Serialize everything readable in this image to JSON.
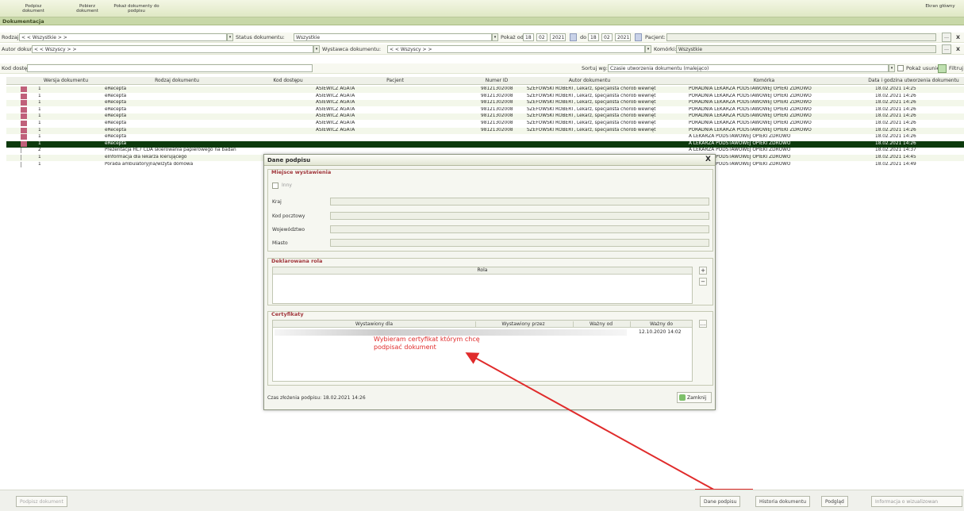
{
  "toolbar": {
    "btn1": "Podpisz dokument",
    "btn2": "Pobierz dokument",
    "btn3": "Pokaż dokumenty do podpisu",
    "right": "Ekran główny"
  },
  "section_title": "Dokumentacja",
  "filters": {
    "rodzaj_label": "Rodzaj:",
    "rodzaj_value": "< < Wszystkie > >",
    "status_label": "Status dokumentu:",
    "status_value": "Wszystkie",
    "pokaz_od_label": "Pokaż od",
    "date_from": [
      "18",
      "02",
      "2021"
    ],
    "do_label": "do",
    "date_to": [
      "18",
      "02",
      "2021"
    ],
    "pacjent_label": "Pacjent:",
    "autor_label": "Autor dokumentu:",
    "autor_value": "< < Wszyscy > >",
    "wystawca_label": "Wystawca dokumentu:",
    "wystawca_value": "< < Wszyscy > >",
    "komorka_label": "Komórki:",
    "komorka_value": "Wszystkie",
    "kod_label": "Kod dostępu:",
    "sortuj_label": "Sortuj wg:",
    "sortuj_value": "Czasie utworzenia dokumentu (malejąco)",
    "pokaz_usuniete": "Pokaż usunięte",
    "filtruj": "Filtruj"
  },
  "table": {
    "headers": [
      "Wersja dokumentu",
      "Rodzaj dokumentu",
      "Kod dostępu",
      "Pacjent",
      "Numer ID",
      "Autor dokumentu",
      "Komórka",
      "Data i godzina utworzenia dokumentu"
    ],
    "rows": [
      {
        "ver": "1",
        "type": "eRecepta",
        "patient": "ASIEWICZ AGATA",
        "id": "98121302008",
        "author": "SZEFOWSKI ROBERT, Lekarz, specjalista chorób wewnęt",
        "unit": "PORADNIA LEKARZA PODSTAWOWEJ OPIEKI ZDROWO",
        "date": "18.02.2021 14:25"
      },
      {
        "ver": "1",
        "type": "eRecepta",
        "patient": "ASIEWICZ AGATA",
        "id": "98121302008",
        "author": "SZEFOWSKI ROBERT, Lekarz, specjalista chorób wewnęt",
        "unit": "PORADNIA LEKARZA PODSTAWOWEJ OPIEKI ZDROWO",
        "date": "18.02.2021 14:26"
      },
      {
        "ver": "1",
        "type": "eRecepta",
        "patient": "ASIEWICZ AGATA",
        "id": "98121302008",
        "author": "SZEFOWSKI ROBERT, Lekarz, specjalista chorób wewnęt",
        "unit": "PORADNIA LEKARZA PODSTAWOWEJ OPIEKI ZDROWO",
        "date": "18.02.2021 14:26"
      },
      {
        "ver": "1",
        "type": "eRecepta",
        "patient": "ASIEWICZ AGATA",
        "id": "98121302008",
        "author": "SZEFOWSKI ROBERT, Lekarz, specjalista chorób wewnęt",
        "unit": "PORADNIA LEKARZA PODSTAWOWEJ OPIEKI ZDROWO",
        "date": "18.02.2021 14:26"
      },
      {
        "ver": "1",
        "type": "eRecepta",
        "patient": "ASIEWICZ AGATA",
        "id": "98121302008",
        "author": "SZEFOWSKI ROBERT, Lekarz, specjalista chorób wewnęt",
        "unit": "PORADNIA LEKARZA PODSTAWOWEJ OPIEKI ZDROWO",
        "date": "18.02.2021 14:26"
      },
      {
        "ver": "1",
        "type": "eRecepta",
        "patient": "ASIEWICZ AGATA",
        "id": "98121302008",
        "author": "SZEFOWSKI ROBERT, Lekarz, specjalista chorób wewnęt",
        "unit": "PORADNIA LEKARZA PODSTAWOWEJ OPIEKI ZDROWO",
        "date": "18.02.2021 14:26"
      },
      {
        "ver": "1",
        "type": "eRecepta",
        "patient": "ASIEWICZ AGATA",
        "id": "98121302008",
        "author": "SZEFOWSKI ROBERT, Lekarz, specjalista chorób wewnęt",
        "unit": "PORADNIA LEKARZA PODSTAWOWEJ OPIEKI ZDROWO",
        "date": "18.02.2021 14:26"
      },
      {
        "ver": "1",
        "type": "eRecepta",
        "patient": "",
        "id": "",
        "author": "",
        "unit": "A LEKARZA PODSTAWOWEJ OPIEKI ZDROWO",
        "date": "18.02.2021 14:26"
      },
      {
        "ver": "1",
        "type": "eRecepta",
        "patient": "",
        "id": "",
        "author": "",
        "unit": "A LEKARZA PODSTAWOWEJ OPIEKI ZDROWO",
        "date": "18.02.2021 14:26"
      },
      {
        "ver": "2",
        "type": "Prezentacja HL7 CDA skierowania papierowego na badan",
        "patient": "",
        "id": "",
        "author": "",
        "unit": "A LEKARZA PODSTAWOWEJ OPIEKI ZDROWO",
        "date": "18.02.2021 14:37"
      },
      {
        "ver": "1",
        "type": "eInformacja dla lekarza kierującego",
        "patient": "",
        "id": "",
        "author": "",
        "unit": "A LEKARZA PODSTAWOWEJ OPIEKI ZDROWO",
        "date": "18.02.2021 14:45"
      },
      {
        "ver": "1",
        "type": "Porada ambulatoryjna/wizyta domowa",
        "patient": "",
        "id": "",
        "author": "",
        "unit": "A LEKARZA PODSTAWOWEJ OPIEKI ZDROWO",
        "date": "18.02.2021 14:49"
      }
    ]
  },
  "dialog": {
    "title": "Dane podpisu",
    "close": "X",
    "miejsce_title": "Miejsce wystawienia",
    "inny": "Inny",
    "kraj": "Kraj",
    "kod_pocztowy": "Kod pocztowy",
    "wojewodztwo": "Województwo",
    "miasto": "Miasto",
    "rola_title": "Deklarowana rola",
    "rola_header": "Rola",
    "cert_title": "Certyfikaty",
    "cert_headers": [
      "Wystawiony dla",
      "Wystawiony przez",
      "Ważny od",
      "Ważny do"
    ],
    "cert_valid_to": "12.10.2020 14:02",
    "annotation": "Wybieram certyfikat którym chcę podpisać dokument",
    "czas_label": "Czas złożenia podpisu: 18.02.2021 14:26",
    "zamknij": "Zamknij"
  },
  "bottom": {
    "podpisz": "Podpisz dokument",
    "dane_podpisu": "Dane podpisu",
    "historia": "Historia dokumentu",
    "podglad": "Podgląd",
    "informacja": "Informacja o wizualizowan"
  },
  "colors": {
    "accent": "#dfe8c4",
    "selected_row": "#0d3a0d",
    "annotation": "#e02b2b"
  }
}
